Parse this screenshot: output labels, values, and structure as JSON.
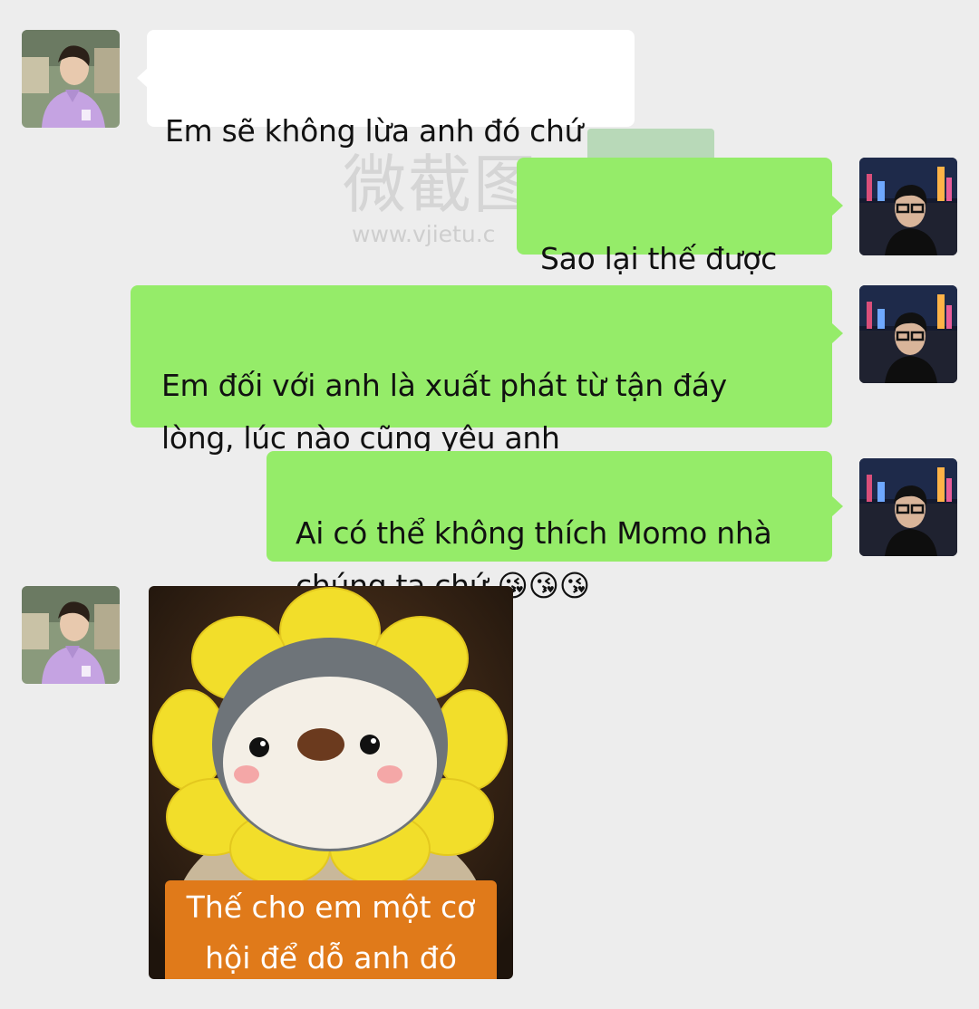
{
  "messages": [
    {
      "side": "left",
      "type": "text",
      "text": "Em sẽ không lừa anh đó chứ"
    },
    {
      "side": "right",
      "type": "text",
      "text": "Sao lại thế được"
    },
    {
      "side": "right",
      "type": "text",
      "text": "Em đối với anh là xuất phát từ tận đáy\nlòng, lúc nào cũng yêu anh"
    },
    {
      "side": "right",
      "type": "text",
      "text": "Ai có thể không thích Momo nhà\nchúng ta chứ 😘😘😘"
    },
    {
      "side": "left",
      "type": "sticker",
      "caption": "Thế cho em một cơ\nhội để dỗ anh đó"
    }
  ],
  "watermark": {
    "title": "微截图",
    "url": "www.vjietu.c"
  },
  "colors": {
    "background": "#ededed",
    "incoming_bubble": "#ffffff",
    "outgoing_bubble": "#95ec69",
    "sticker_caption": "#e07a1a"
  },
  "icons": {
    "incoming_avatar": "avatar-boy-purple-hoodie",
    "outgoing_avatar": "avatar-man-glasses-night-city"
  }
}
